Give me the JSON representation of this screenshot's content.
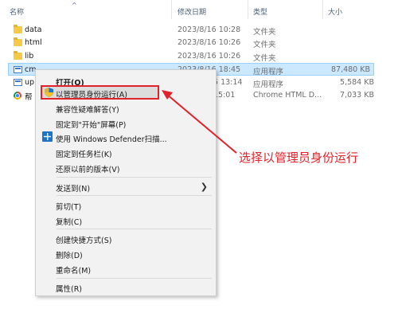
{
  "header": {
    "name": "名称",
    "date": "修改日期",
    "type": "类型",
    "size": "大小",
    "sort_indicator": "^"
  },
  "rows": [
    {
      "name": "data",
      "date": "2023/8/16 10:28",
      "type": "文件夹",
      "size": "",
      "icon": "folder-icon"
    },
    {
      "name": "html",
      "date": "2023/8/16 10:26",
      "type": "文件夹",
      "size": "",
      "icon": "folder-icon"
    },
    {
      "name": "lib",
      "date": "2023/8/16 10:26",
      "type": "文件夹",
      "size": "",
      "icon": "folder-icon"
    },
    {
      "name": "cm",
      "date": "2023/8/16 18:45",
      "type": "应用程序",
      "size": "87,480 KB",
      "icon": "application-icon"
    },
    {
      "name": "up",
      "date": "5 13:14",
      "type": "应用程序",
      "size": "5,584 KB",
      "icon": "application-icon"
    },
    {
      "name": "帮",
      "date": "15:01",
      "type": "Chrome HTML D...",
      "size": "7,033 KB",
      "icon": "chrome-icon"
    }
  ],
  "menu": {
    "open": "打开(O)",
    "run_as_admin": "以管理员身份运行(A)",
    "troubleshoot": "兼容性疑难解答(Y)",
    "pin_start": "固定到\"开始\"屏幕(P)",
    "defender": "使用 Windows Defender扫描...",
    "pin_taskbar": "固定到任务栏(K)",
    "restore": "还原以前的版本(V)",
    "send_to": "发送到(N)",
    "cut": "剪切(T)",
    "copy": "复制(C)",
    "create_shortcut": "创建快捷方式(S)",
    "delete": "删除(D)",
    "rename": "重命名(M)",
    "properties": "属性(R)"
  },
  "annotation": {
    "text": "选择以管理员身份运行",
    "color": "#e0232b"
  }
}
